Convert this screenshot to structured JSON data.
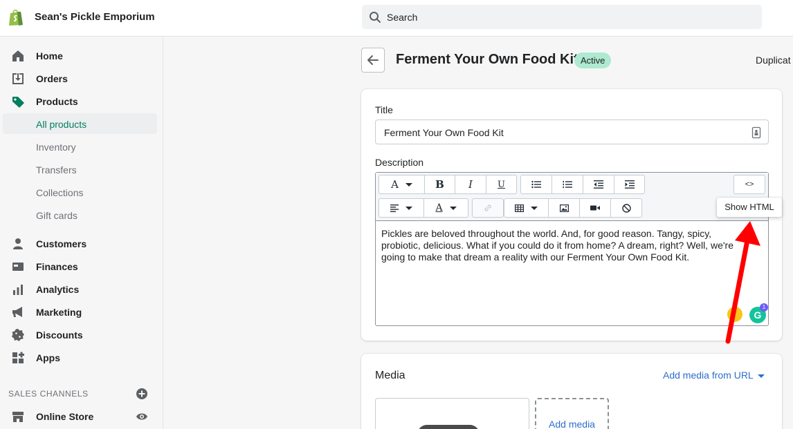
{
  "topbar": {
    "store_name": "Sean's Pickle Emporium",
    "search_placeholder": "Search",
    "logo_icon": "shopify-bag-icon"
  },
  "sidebar": {
    "items": [
      {
        "label": "Home",
        "icon": "home-icon"
      },
      {
        "label": "Orders",
        "icon": "orders-icon"
      },
      {
        "label": "Products",
        "icon": "tag-icon"
      },
      {
        "label": "Customers",
        "icon": "person-icon"
      },
      {
        "label": "Finances",
        "icon": "finances-icon"
      },
      {
        "label": "Analytics",
        "icon": "bar-chart-icon"
      },
      {
        "label": "Marketing",
        "icon": "megaphone-icon"
      },
      {
        "label": "Discounts",
        "icon": "discount-icon"
      },
      {
        "label": "Apps",
        "icon": "apps-icon"
      }
    ],
    "product_subitems": [
      "All products",
      "Inventory",
      "Transfers",
      "Collections",
      "Gift cards"
    ],
    "active_subitem": "All products",
    "sales_channels_label": "SALES CHANNELS",
    "online_store_label": "Online Store"
  },
  "header": {
    "title": "Ferment Your Own Food Kit",
    "status_badge": "Active",
    "duplicate_label": "Duplicat"
  },
  "product_form": {
    "title_label": "Title",
    "title_value": "Ferment Your Own Food Kit",
    "description_label": "Description",
    "description_text": "Pickles are beloved throughout the world. And, for good reason. Tangy, spicy, probiotic, delicious. What if you could do it from home? A dream, right? Well, we're going to make that dream a reality with our Ferment Your Own Food Kit.",
    "toolbar": {
      "font_label": "A",
      "bold_label": "B",
      "italic_label": "I",
      "underline_label": "U",
      "text_color_label": "A",
      "html_button_label": "<>",
      "tooltip_text": "Show HTML"
    },
    "grammarly_label": "G",
    "grammarly_count": "1"
  },
  "media": {
    "title": "Media",
    "add_from_url": "Add media from URL",
    "add_media": "Add media"
  },
  "colors": {
    "accent_green": "#007f5f",
    "badge_green": "#aee9d1",
    "link_blue": "#2c6ecb",
    "arrow_red": "#ff0000"
  }
}
